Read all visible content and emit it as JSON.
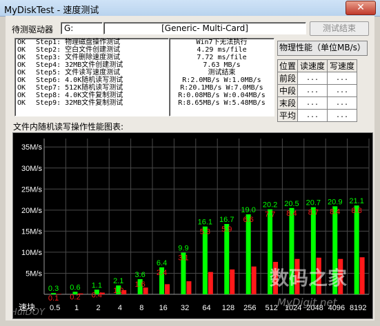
{
  "window": {
    "title": "MyDiskTest - 速度测试",
    "close_label": "✕"
  },
  "drive": {
    "label": "待测驱动器",
    "letter": "G:",
    "name": "[Generic- Multi-Card]",
    "finish_button": "测试结束"
  },
  "steps": [
    {
      "status": "OK",
      "text": "Step1: 物理磁盘操作测试"
    },
    {
      "status": "OK",
      "text": "Step2: 空白文件创建测试"
    },
    {
      "status": "OK",
      "text": "Step3: 文件删除速度测试"
    },
    {
      "status": "OK",
      "text": "Step4: 32MB文件创建测试"
    },
    {
      "status": "OK",
      "text": "Step5: 文件读写速度测试"
    },
    {
      "status": "OK",
      "text": "Step6: 4.0K随机读写测试"
    },
    {
      "status": "OK",
      "text": "Step7: 512K随机读写测试"
    },
    {
      "status": "OK",
      "text": "Step8: 4.0K文件复制测试"
    },
    {
      "status": "OK",
      "text": "Step9: 32MB文件复制测试"
    }
  ],
  "results": [
    "Win7下无法执行",
    "4.29 ms/file",
    "7.72 ms/file",
    "7.63 MB/s",
    "测试结束",
    "R:2.0MB/s W:1.0MB/s",
    "R:20.1MB/s W:7.0MB/s",
    "R:0.08MB/s W:0.04MB/s",
    "R:8.65MB/s W:5.48MB/s"
  ],
  "perf": {
    "title": "物理性能（单位MB/s）",
    "headers": [
      "位置",
      "读速度",
      "写速度"
    ],
    "rows": [
      {
        "pos": "前段",
        "read": "...",
        "write": "..."
      },
      {
        "pos": "中段",
        "read": "...",
        "write": "..."
      },
      {
        "pos": "末段",
        "read": "...",
        "write": "..."
      },
      {
        "pos": "平均",
        "read": "...",
        "write": "..."
      }
    ]
  },
  "chart_title": "文件内随机读写操作性能图表:",
  "chart_data": {
    "type": "bar",
    "categories": [
      "0.5",
      "1",
      "2",
      "4",
      "8",
      "16",
      "32",
      "64",
      "128",
      "256",
      "512",
      "1024",
      "2048",
      "4096",
      "8192"
    ],
    "first_tick_label": "速块",
    "yticks": [
      "5M/s",
      "10M/s",
      "15M/s",
      "20M/s",
      "25M/s",
      "30M/s",
      "35M/s"
    ],
    "ylim": [
      0,
      37
    ],
    "series": [
      {
        "values": [
          0.3,
          0.6,
          1.1,
          2.1,
          3.6,
          6.4,
          9.9,
          16.1,
          16.7,
          19.0,
          20.2,
          20.5,
          20.7,
          20.9,
          21.1
        ],
        "color": "#00ff00"
      },
      {
        "values": [
          0.1,
          0.2,
          0.4,
          1.0,
          1.6,
          2.4,
          3.1,
          5.3,
          5.9,
          6.6,
          7.7,
          8.4,
          8.7,
          8.4,
          8.8
        ],
        "color": "#ff1a1a"
      }
    ]
  },
  "watermarks": {
    "site_cn": "数码之家",
    "site_url": "MyDigit.net",
    "corner": "HuiDOY"
  }
}
